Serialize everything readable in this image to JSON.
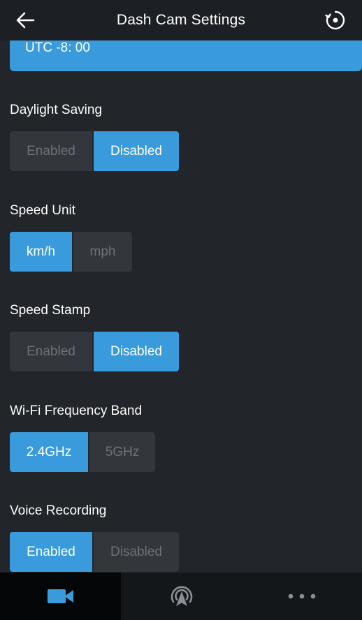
{
  "header": {
    "title": "Dash Cam Settings",
    "back_icon": "back-arrow-icon",
    "reset_icon": "reset-icon"
  },
  "timezone": {
    "value": "UTC -8: 00"
  },
  "settings": {
    "daylight_saving": {
      "label": "Daylight Saving",
      "options": [
        "Enabled",
        "Disabled"
      ],
      "selected": "Disabled"
    },
    "speed_unit": {
      "label": "Speed Unit",
      "options": [
        "km/h",
        "mph"
      ],
      "selected": "km/h"
    },
    "speed_stamp": {
      "label": "Speed Stamp",
      "options": [
        "Enabled",
        "Disabled"
      ],
      "selected": "Disabled"
    },
    "wifi_band": {
      "label": "Wi-Fi Frequency Band",
      "options": [
        "2.4GHz",
        "5GHz"
      ],
      "selected": "2.4GHz"
    },
    "voice_recording": {
      "label": "Voice Recording",
      "options": [
        "Enabled",
        "Disabled"
      ],
      "selected": "Enabled"
    }
  },
  "tabbar": {
    "items": [
      {
        "icon": "video-camera-icon",
        "active": true
      },
      {
        "icon": "signal-navigation-icon",
        "active": false
      },
      {
        "icon": "more-dots-icon",
        "active": false
      }
    ]
  },
  "colors": {
    "accent": "#3a9bdc",
    "background": "#22252a",
    "header": "#1c1f23",
    "inactive_option": "#33373c",
    "inactive_text": "#6c7278"
  }
}
